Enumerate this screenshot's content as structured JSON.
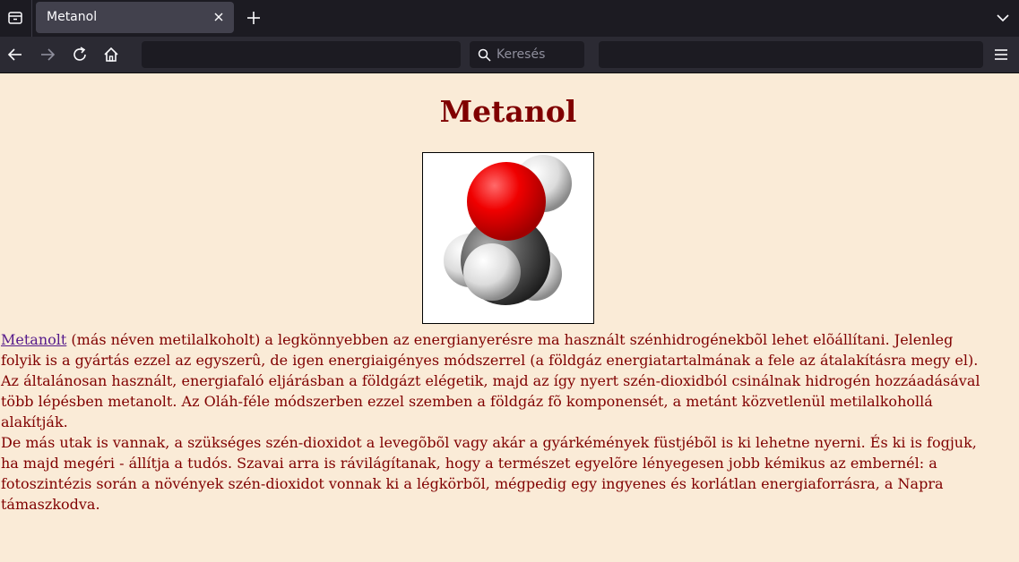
{
  "browser": {
    "tab_title": "Metanol",
    "search_placeholder": "Keresés"
  },
  "page": {
    "title": "Metanol",
    "image_description": "methanol space-filling molecule model",
    "link_text": "Metanolt",
    "para1_rest": " (más néven metilalkoholt) a legkönnyebben az energianyerésre ma használt szénhidrogénekbõl lehet elõállítani. Jelenleg folyik is a gyártás ezzel az egyszerû, de igen energiaigényes módszerrel (a földgáz energiatartalmának a fele az átalakításra megy el).",
    "para2": "Az általánosan használt, energiafaló eljárásban a földgázt elégetik, majd az így nyert szén-dioxidból csinálnak hidrogén hozzáadásával több lépésben metanolt. Az Oláh-féle módszerben ezzel szemben a földgáz fõ komponensét, a metánt közvetlenül metilalkohollá alakítják.",
    "para3": "De más utak is vannak, a szükséges szén-dioxidot a levegõbõl vagy akár a gyárkémények füstjébõl is ki lehetne nyerni. És ki is fogjuk, ha majd megéri - állítja a tudós. Szavai arra is rávilágítanak, hogy a természet egyelõre lényegesen jobb kémikus az embernél: a fotoszintézis során a növények szén-dioxidot vonnak ki a légkörbõl, mégpedig egy ingyenes és korlátlan energiaforrásra, a Napra támaszkodva."
  },
  "colors": {
    "page_bg": "#faebd7",
    "text": "#800000",
    "link": "#551a8b",
    "oxygen": "#e00000",
    "carbon": "#555555",
    "hydrogen": "#eeeeee"
  }
}
